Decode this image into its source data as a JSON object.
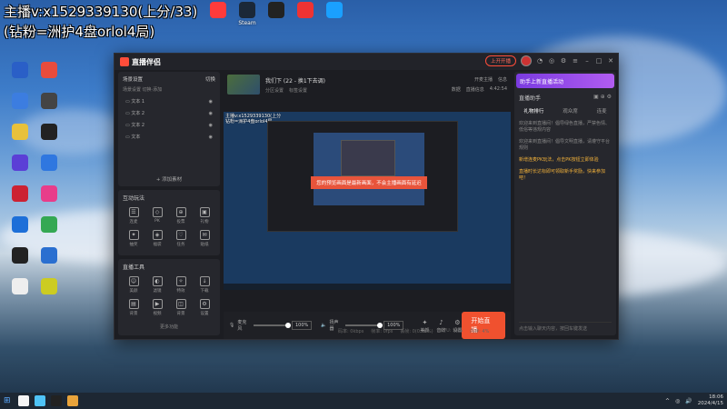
{
  "overlay": {
    "line1": "主播v:x1529339130(上分/33)",
    "line2": "(钻粉=洲护4盘orlol4局)"
  },
  "desktop_icons_top": [
    {
      "label": "",
      "color": "#ff3b3b"
    },
    {
      "label": "Steam",
      "color": "#1b2838"
    },
    {
      "label": "",
      "color": "#222"
    },
    {
      "label": "",
      "color": "#e33"
    },
    {
      "label": "",
      "color": "#1aa0ff"
    }
  ],
  "desktop_icons_left": [
    {
      "label": "",
      "color": "#2a5fc7"
    },
    {
      "label": "",
      "color": "#e84c3d"
    },
    {
      "label": "",
      "color": "#3c7de0"
    },
    {
      "label": "",
      "color": "#444"
    },
    {
      "label": "",
      "color": "#e8c13b"
    },
    {
      "label": "",
      "color": "#222"
    },
    {
      "label": "",
      "color": "#5b3fd6"
    },
    {
      "label": "",
      "color": "#2f77e0"
    },
    {
      "label": "",
      "color": "#c23"
    },
    {
      "label": "",
      "color": "#e83d8a"
    },
    {
      "label": "",
      "color": "#1d6fd8"
    },
    {
      "label": "",
      "color": "#34a853"
    },
    {
      "label": "",
      "color": "#222"
    },
    {
      "label": "",
      "color": "#2a6fd0"
    },
    {
      "label": "",
      "color": "#eee"
    },
    {
      "label": "",
      "color": "#cc2"
    }
  ],
  "app": {
    "name": "直播伴侣",
    "live_pill": "上开开播",
    "room_title": "我们下 (22 - 换1下去调)",
    "room_tags": [
      "分区设置",
      "标签设置"
    ],
    "top_actions_row1": [
      "开麦主播",
      "信息"
    ],
    "top_actions_row2": [
      "数据",
      "直播信息",
      "4:42:54"
    ]
  },
  "scenes": {
    "header": "场景设置",
    "header_right": "切换",
    "sub": "场景设置   切换·添加",
    "sources": [
      "文本 1",
      "文本 2",
      "文本 2",
      "文本"
    ],
    "add_label": "+ 添加素材"
  },
  "interaction": {
    "title": "互动玩法",
    "tools": [
      "连麦",
      "PK",
      "投票",
      "礼物",
      "抽奖",
      "福袋",
      "任务",
      "贴纸"
    ]
  },
  "live_tools": {
    "title": "直播工具",
    "tools": [
      "美颜",
      "滤镜",
      "特效",
      "下载",
      "背景",
      "视频",
      "背景",
      "设置"
    ]
  },
  "more_label": "更多功能",
  "preview": {
    "toast": "您的预览画面是最新画面，不会主播画面有延迟",
    "text": "主播v:x1529339130(上分\n钻粉=洲护4盘orlol4局"
  },
  "controls": {
    "mic_label": "麦克风",
    "mic_value": "100%",
    "speaker_label": "扬声器",
    "speaker_value": "100%",
    "btn1": "美颜",
    "btn2": "音效",
    "btn3": "设置",
    "start_label": "开始直播"
  },
  "status_line": [
    "码率: 0kbps",
    "帧率: 0fps",
    "丢帧: 0(0.00%)",
    "CPU: 15%",
    "内存: 4%"
  ],
  "right": {
    "promo": "助手上新直播活动",
    "head": "直播助手",
    "tabs": [
      "礼物排行",
      "观众席",
      "连麦"
    ],
    "messages": [
      {
        "text": "欢迎来到直播间！倡导绿色直播，严禁色情、低俗等违规内容",
        "hl": false
      },
      {
        "text": "欢迎来到直播间！倡导文明直播，请遵守平台规则",
        "hl": false
      },
      {
        "text": "新增连麦PK玩法，点击PK按钮立即体验",
        "hl": true
      },
      {
        "text": "直播时长达标即可领取新手奖励，快来参加吧！",
        "hl": true
      }
    ],
    "foot": "点击输入聊天内容，按回车键发送"
  },
  "taskbar": {
    "time": "18:06",
    "date": "2024/4/15",
    "icons": [
      "#f5f5f5",
      "#4fc3f7",
      "#222",
      "#e8a33b"
    ]
  }
}
